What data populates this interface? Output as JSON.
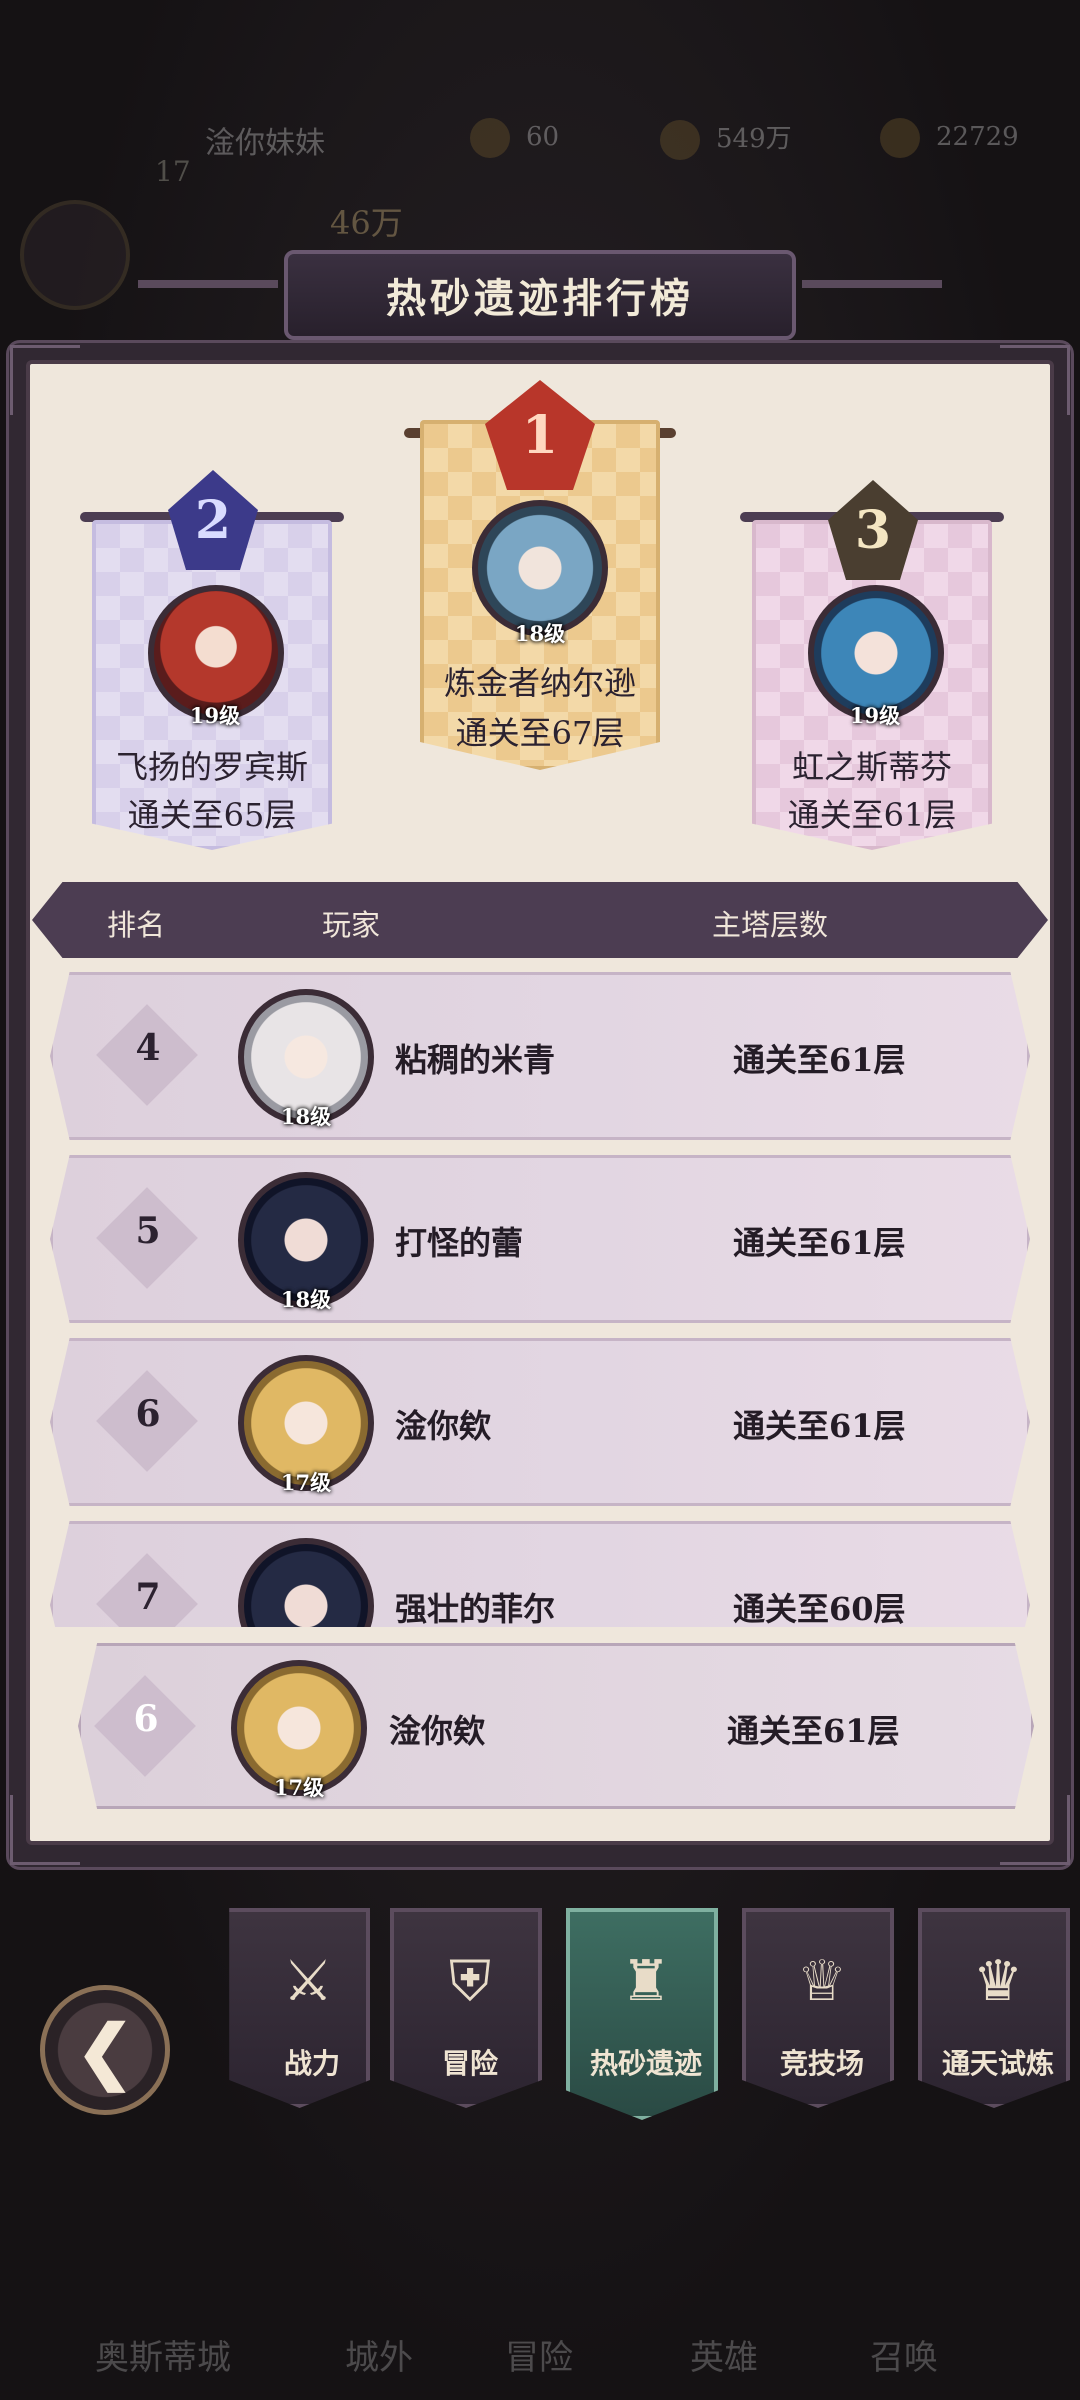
{
  "background": {
    "player_level": "17",
    "player_name": "淦你妹妹",
    "res_1": "60",
    "res_2": "549万",
    "res_3": "22729",
    "power": "46万",
    "nav_items": [
      "奥斯蒂城",
      "城外",
      "冒险",
      "英雄",
      "召唤"
    ]
  },
  "panel": {
    "title": "热砂遗迹排行榜"
  },
  "podium": [
    {
      "rank": "1",
      "level": "18级",
      "name": "炼金者纳尔逊",
      "score": "通关至67层"
    },
    {
      "rank": "2",
      "level": "19级",
      "name": "飞扬的罗宾斯",
      "score": "通关至65层"
    },
    {
      "rank": "3",
      "level": "19级",
      "name": "虹之斯蒂芬",
      "score": "通关至61层"
    }
  ],
  "table_header": {
    "rank": "排名",
    "player": "玩家",
    "floors": "主塔层数"
  },
  "rows": [
    {
      "rank": "4",
      "level": "18级",
      "name": "粘稠的米青",
      "score": "通关至61层"
    },
    {
      "rank": "5",
      "level": "18级",
      "name": "打怪的蕾",
      "score": "通关至61层"
    },
    {
      "rank": "6",
      "level": "17级",
      "name": "淦你欸",
      "score": "通关至61层"
    },
    {
      "rank": "7",
      "level": "",
      "name": "强壮的菲尔",
      "score": "通关至60层"
    }
  ],
  "self_row": {
    "rank": "6",
    "level": "17级",
    "name": "淦你欸",
    "score": "通关至61层"
  },
  "tabs": [
    {
      "label": "战力",
      "icon": "crossed-swords-icon"
    },
    {
      "label": "冒险",
      "icon": "shield-sword-icon"
    },
    {
      "label": "热砂遗迹",
      "icon": "tower-icon"
    },
    {
      "label": "竞技场",
      "icon": "trophy-icon"
    },
    {
      "label": "通天试炼",
      "icon": "crown-icon"
    }
  ],
  "back_icon": "back-arrow-icon"
}
